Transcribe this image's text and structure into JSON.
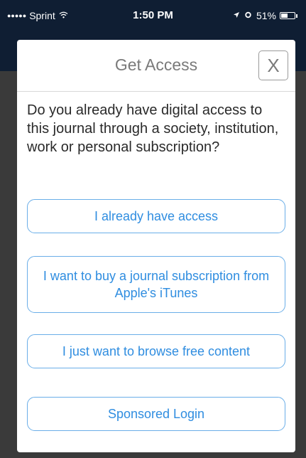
{
  "status_bar": {
    "signal": "●●●●●",
    "carrier": "Sprint",
    "wifi_icon": "wifi-icon",
    "time": "1:50 PM",
    "battery_percent": "51%",
    "battery_level": 0.51
  },
  "modal": {
    "title": "Get Access",
    "close_label": "X",
    "question": "Do you already have digital access to this journal through a society, institution, work or personal subscription?",
    "options": [
      {
        "label": "I already have access"
      },
      {
        "label": "I want to buy a journal subscription from Apple's iTunes"
      },
      {
        "label": "I just want to browse free content"
      },
      {
        "label": "Sponsored Login"
      }
    ]
  },
  "colors": {
    "nav_bar": "#0f1e33",
    "accent": "#2f8de0",
    "button_border": "#6aaee8",
    "backdrop": "#3a3a3a"
  }
}
